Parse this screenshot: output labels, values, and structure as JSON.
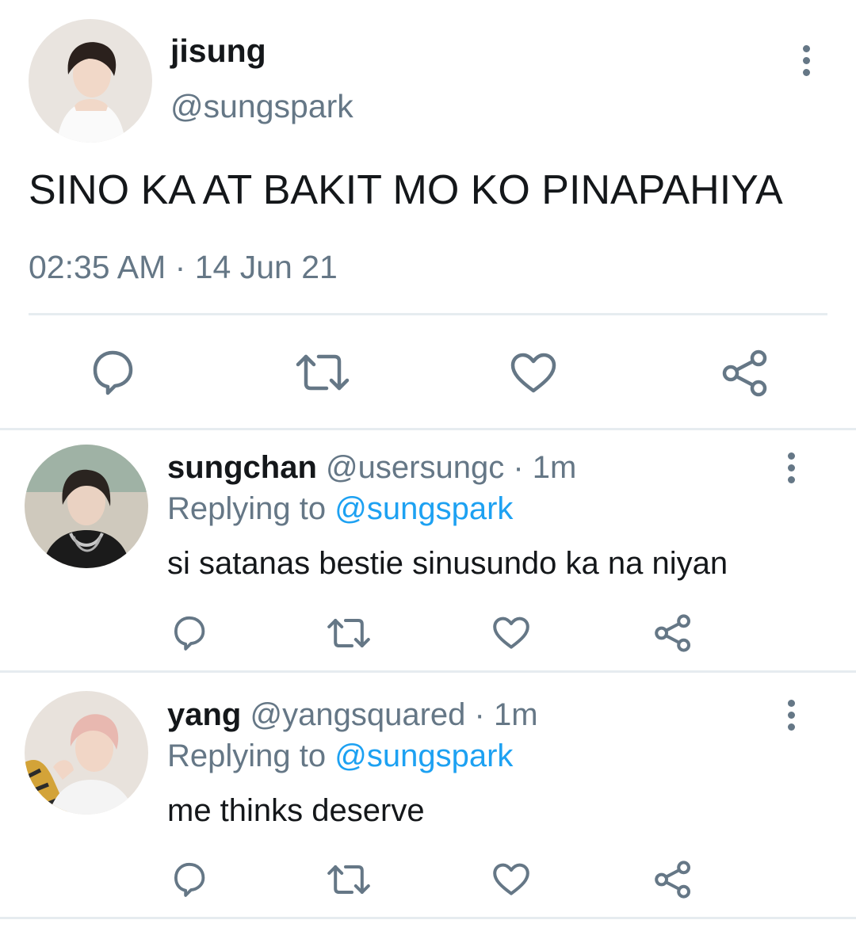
{
  "tweet": {
    "display_name": "jisung",
    "handle": "@sungspark",
    "text": "SINO KA AT BAKIT MO KO PINAPAHIYA",
    "time": "02:35 AM",
    "separator": "·",
    "date": "14 Jun 21",
    "actions": [
      "reply-icon",
      "retweet-icon",
      "like-icon",
      "share-icon"
    ]
  },
  "replies": [
    {
      "display_name": "sungchan",
      "handle": "@usersungc",
      "age": "· 1m",
      "replying_prefix": "Replying to",
      "replying_to": "@sungspark",
      "text": "si satanas bestie sinusundo ka na niyan"
    },
    {
      "display_name": "yang",
      "handle": "@yangsquared",
      "age": "· 1m",
      "replying_prefix": "Replying to",
      "replying_to": "@sungspark",
      "text": "me thinks deserve"
    }
  ],
  "colors": {
    "text": "#14171a",
    "muted": "#657786",
    "link": "#1da1f2",
    "divider": "#e6ecf0"
  }
}
